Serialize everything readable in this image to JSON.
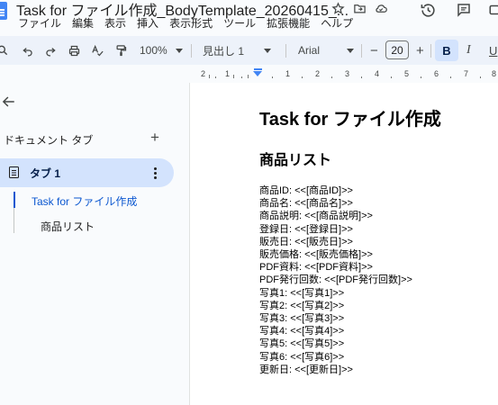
{
  "window": {
    "doc_title": "Task for ファイル作成_BodyTemplate_20260415_..."
  },
  "menu": [
    "ファイル",
    "編集",
    "表示",
    "挿入",
    "表示形式",
    "ツール",
    "拡張機能",
    "ヘルプ"
  ],
  "toolbar": {
    "zoom": "100%",
    "style": "見出し 1",
    "font": "Arial",
    "font_size": "20",
    "bold": "B",
    "italic": "I",
    "underline": "U",
    "minus": "−",
    "plus": "+"
  },
  "ruler": {
    "labels": [
      "2",
      "1",
      "1",
      "2",
      "3",
      "4",
      "5",
      "6",
      "7",
      "8"
    ]
  },
  "sidebar": {
    "header": "ドキュメント タブ",
    "add_label": "+",
    "tab_label": "タブ 1",
    "outline": {
      "heading1": "Task for ファイル作成",
      "heading2": "商品リスト"
    }
  },
  "document": {
    "title": "Task for ファイル作成",
    "heading": "商品リスト",
    "lines": [
      "商品ID: <<[商品ID]>>",
      "商品名: <<[商品名]>>",
      "商品説明: <<[商品説明]>>",
      "登録日: <<[登録日]>>",
      "販売日: <<[販売日]>>",
      "販売価格: <<[販売価格]>>",
      "PDF資料: <<[PDF資料]>>",
      "PDF発行回数: <<[PDF発行回数]>>",
      "写真1: <<[写真1]>>",
      "写真2: <<[写真2]>>",
      "写真3: <<[写真3]>>",
      "写真4: <<[写真4]>>",
      "写真5: <<[写真5]>>",
      "写真6: <<[写真6]>>",
      "更新日: <<[更新日]>>"
    ]
  },
  "colors": {
    "accent": "#0b57d0",
    "tab_bg": "#d3e3fd",
    "toolbar_bg": "#edf2fa",
    "app_bg": "#f9fbfd"
  }
}
